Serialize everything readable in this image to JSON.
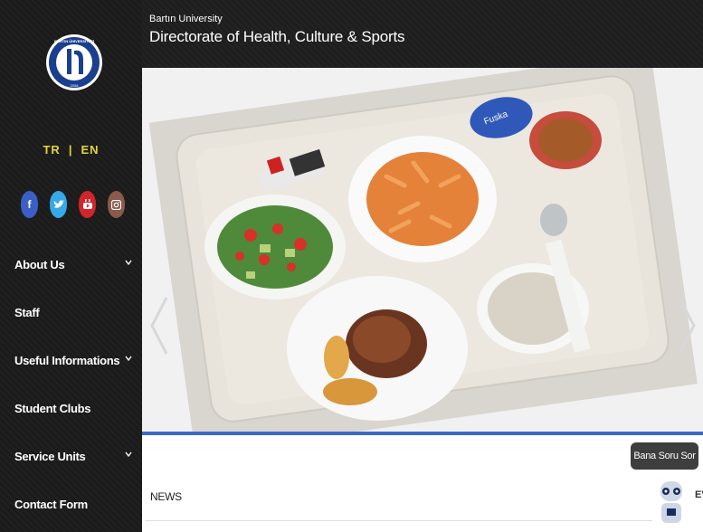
{
  "header": {
    "university": "Bartın University",
    "directorate": "Directorate of Health, Culture & Sports"
  },
  "logo": {
    "text_top": "BARTIN ÜNİVERSİTESİ",
    "year": "2008"
  },
  "languages": {
    "tr": "TR",
    "separator": "|",
    "en": "EN"
  },
  "socials": [
    {
      "icon": "facebook-icon",
      "glyph": "f",
      "color": "#3b5fc7"
    },
    {
      "icon": "twitter-icon",
      "glyph": "t",
      "color": "#36a9e9"
    },
    {
      "icon": "youtube-icon",
      "glyph": "▶",
      "color": "#d0262a"
    },
    {
      "icon": "instagram-icon",
      "glyph": "◎",
      "color": "#8a5a4a"
    }
  ],
  "nav": [
    {
      "label": "About Us",
      "has_submenu": true
    },
    {
      "label": "Staff",
      "has_submenu": false
    },
    {
      "label": "Useful Informations",
      "has_submenu": true
    },
    {
      "label": "Student Clubs",
      "has_submenu": false
    },
    {
      "label": "Service Units",
      "has_submenu": true
    },
    {
      "label": "Contact Form",
      "has_submenu": false
    }
  ],
  "slider": {
    "photo_alt": "Cafeteria meal tray",
    "tray_labels": {
      "water": "Fuska",
      "salt": "",
      "pepper": ""
    }
  },
  "news": {
    "title": "NEWS"
  },
  "chatbot": {
    "button_label": "Bana Soru Sor",
    "side_text": "EV"
  },
  "colors": {
    "sidebar_bg": "#1b1b1b",
    "accent": "#3b69c9",
    "lang": "#e5d33a"
  }
}
